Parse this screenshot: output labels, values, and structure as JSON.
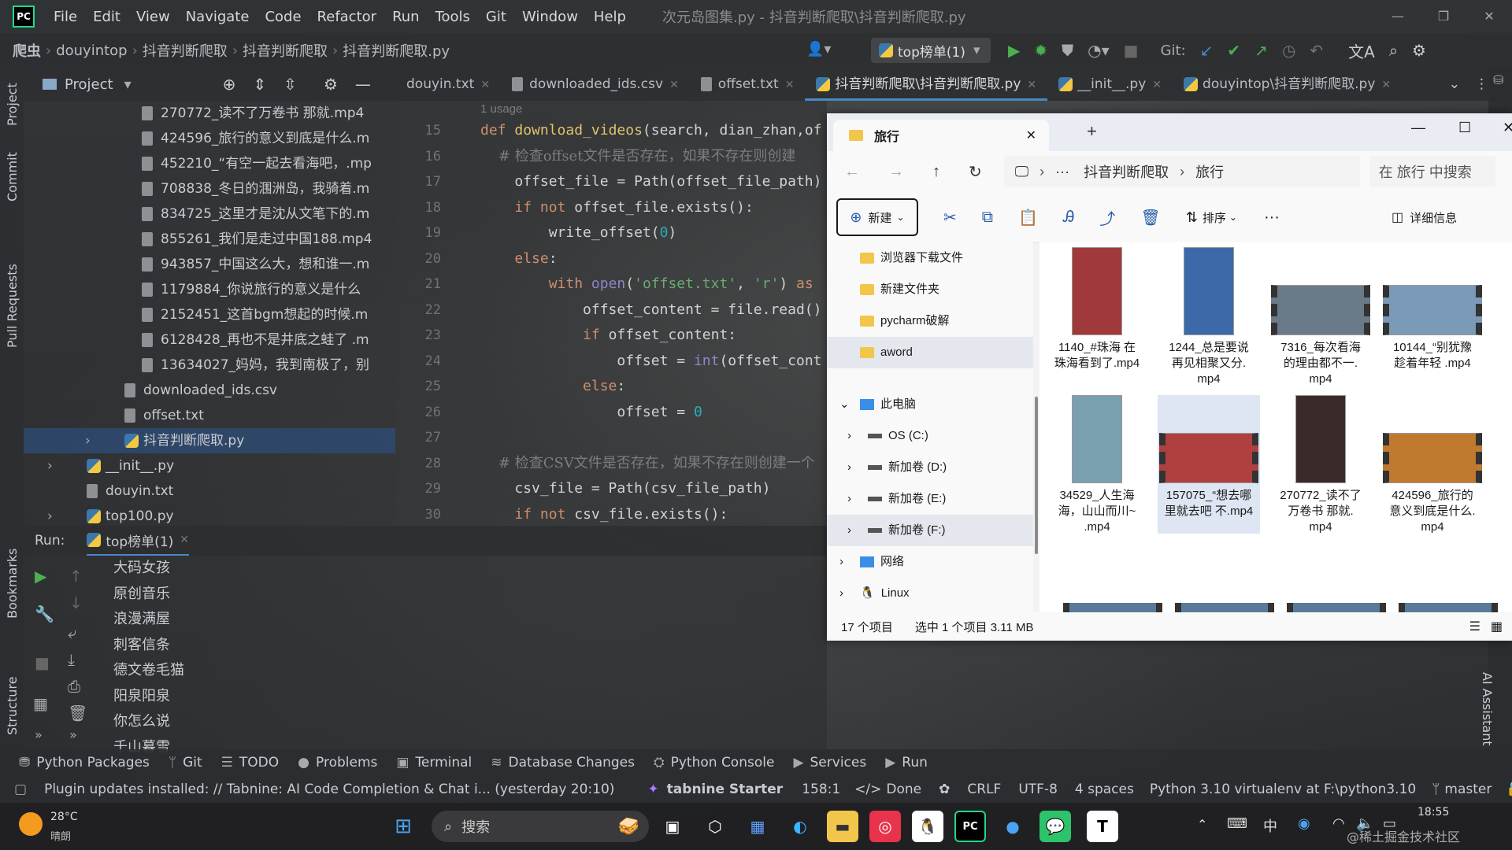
{
  "window": {
    "menu": [
      "File",
      "Edit",
      "View",
      "Navigate",
      "Code",
      "Refactor",
      "Run",
      "Tools",
      "Git",
      "Window",
      "Help"
    ],
    "title": "次元岛图集.py - 抖音判断爬取\\抖音判断爬取.py"
  },
  "navbar": {
    "crumbs": [
      "爬虫",
      "douyintop",
      "抖音判断爬取",
      "抖音判断爬取",
      "抖音判断爬取.py"
    ],
    "run_config": "top榜单(1)",
    "git_label": "Git:"
  },
  "leftstrip": {
    "project": "Project",
    "commit": "Commit",
    "pull": "Pull Requests",
    "bookmarks": "Bookmarks",
    "structure": "Structure"
  },
  "project": {
    "header": "Project",
    "rows": [
      {
        "label": "270772_读不了万卷书  那就.mp4",
        "indent": 180,
        "kind": "file"
      },
      {
        "label": "424596_旅行的意义到底是什么.m",
        "indent": 180,
        "kind": "file"
      },
      {
        "label": "452210_“有空一起去看海吧，.mp",
        "indent": 180,
        "kind": "file"
      },
      {
        "label": "708838_冬日的涠洲岛，我骑着.m",
        "indent": 180,
        "kind": "file"
      },
      {
        "label": "834725_这里才是沈从文笔下的.m",
        "indent": 180,
        "kind": "file"
      },
      {
        "label": "855261_我们是走过中国188.mp4",
        "indent": 180,
        "kind": "file"
      },
      {
        "label": "943857_中国这么大，想和谁一.m",
        "indent": 180,
        "kind": "file"
      },
      {
        "label": "1179884_你说旅行的意义是什么",
        "indent": 180,
        "kind": "file"
      },
      {
        "label": "2152451_这首bgm想起的时候.m",
        "indent": 180,
        "kind": "file"
      },
      {
        "label": "6128428_再也不是井底之蛙了 .m",
        "indent": 180,
        "kind": "file"
      },
      {
        "label": "13634027_妈妈，我到南极了，别",
        "indent": 180,
        "kind": "file"
      },
      {
        "label": "downloaded_ids.csv",
        "indent": 158,
        "kind": "file"
      },
      {
        "label": "offset.txt",
        "indent": 158,
        "kind": "file"
      },
      {
        "label": "抖音判断爬取.py",
        "indent": 158,
        "kind": "py",
        "sel": true
      },
      {
        "label": "__init__.py",
        "indent": 110,
        "kind": "py"
      },
      {
        "label": "douyin.txt",
        "indent": 110,
        "kind": "file"
      },
      {
        "label": "top100.py",
        "indent": 110,
        "kind": "py"
      }
    ]
  },
  "tabs": [
    {
      "label": "douyin.txt"
    },
    {
      "label": "downloaded_ids.csv"
    },
    {
      "label": "offset.txt"
    },
    {
      "label": "抖音判断爬取\\抖音判断爬取.py",
      "active": true
    },
    {
      "label": "__init__.py"
    },
    {
      "label": "douyintop\\抖音判断爬取.py"
    }
  ],
  "editor": {
    "usage": "1 usage",
    "line_numbers": [
      "15",
      "16",
      "17",
      "18",
      "19",
      "20",
      "21",
      "22",
      "23",
      "24",
      "25",
      "26",
      "27",
      "28",
      "29",
      "30"
    ],
    "lines": [
      "def download_videos(search, dian_zhan,of",
      "    # 检查offset文件是否存在，如果不存在则创建",
      "    offset_file = Path(offset_file_path)",
      "    if not offset_file.exists():",
      "        write_offset(0)",
      "    else:",
      "        with open('offset.txt', 'r') as",
      "            offset_content = file.read()",
      "            if offset_content:",
      "                offset = int(offset_cont",
      "            else:",
      "                offset = 0",
      "",
      "    # 检查CSV文件是否存在，如果不存在则创建一个",
      "    csv_file = Path(csv_file_path)",
      "    if not csv_file.exists():"
    ]
  },
  "run": {
    "label": "Run:",
    "tab": "top榜单(1)",
    "output": [
      "大码女孩",
      "原创音乐",
      "浪漫满屋",
      "刺客信条",
      "德文卷毛猫",
      "阳泉阳泉",
      "你怎么说",
      "千山暮雪"
    ]
  },
  "bottom_tools": [
    "Python Packages",
    "Git",
    "TODO",
    "Problems",
    "Terminal",
    "Database Changes",
    "Python Console",
    "Services",
    "Run"
  ],
  "status": {
    "message": "Plugin updates installed: // Tabnine: AI Code Completion & Chat i... (yesterday 20:10)",
    "tabnine": "tabnine Starter",
    "position": "158:1",
    "done": "Done",
    "eol": "CRLF",
    "encoding": "UTF-8",
    "indent": "4 spaces",
    "interpreter": "Python 3.10 virtualenv at F:\\python3.10",
    "branch": "master"
  },
  "rightstrip": {
    "ai": "AI Assistant"
  },
  "explorer": {
    "tab_title": "旅行",
    "path": [
      "抖音判断爬取",
      "旅行"
    ],
    "search_placeholder": "在 旅行 中搜索",
    "new_label": "新建",
    "sort_label": "排序",
    "details_label": "详细信息",
    "nav": [
      {
        "label": "浏览器下载文件",
        "kind": "folder"
      },
      {
        "label": "新建文件夹",
        "kind": "folder"
      },
      {
        "label": "pycharm破解",
        "kind": "folder"
      },
      {
        "label": "aword",
        "kind": "folder",
        "sel": true
      },
      {
        "label": "此电脑",
        "kind": "pc",
        "expanded": true
      },
      {
        "label": "OS (C:)",
        "kind": "drive"
      },
      {
        "label": "新加卷 (D:)",
        "kind": "drive"
      },
      {
        "label": "新加卷 (E:)",
        "kind": "drive"
      },
      {
        "label": "新加卷 (F:)",
        "kind": "drive",
        "sel": true
      },
      {
        "label": "网络",
        "kind": "net"
      },
      {
        "label": "Linux",
        "kind": "linux"
      }
    ],
    "items": [
      {
        "l1": "1140_#珠海 在",
        "l2": "珠海看到了.mp4",
        "l3": "",
        "color": "#a03a3a"
      },
      {
        "l1": "1244_总是要说",
        "l2": "再见相聚又分.",
        "l3": "mp4",
        "color": "#3c6aa8"
      },
      {
        "l1": "7316_每次看海",
        "l2": "的理由都不一.",
        "l3": "mp4",
        "color": "#6a7a88"
      },
      {
        "l1": "10144_“别犹豫",
        "l2": "趁着年轻 .mp4",
        "l3": "",
        "color": "#7a9ab8"
      },
      {
        "l1": "34529_人生海",
        "l2": "海，山山而川~",
        "l3": ".mp4",
        "color": "#7aa0b0"
      },
      {
        "l1": "157075_“想去哪",
        "l2": "里就去吧 不.mp4",
        "l3": "",
        "color": "#b04040",
        "sel": true
      },
      {
        "l1": "270772_读不了",
        "l2": "万卷书  那就.",
        "l3": "mp4",
        "color": "#3a2a2a"
      },
      {
        "l1": "424596_旅行的",
        "l2": "意义到底是什么.",
        "l3": "mp4",
        "color": "#c07a30"
      }
    ],
    "count": "17 个项目",
    "selected": "选中 1 个项目  3.11 MB"
  },
  "taskbar": {
    "weather_temp": "28°C",
    "weather_text": "晴朗",
    "search": "搜索",
    "ime": "中",
    "time": "18:55",
    "watermark": "@稀土掘金技术社区"
  }
}
